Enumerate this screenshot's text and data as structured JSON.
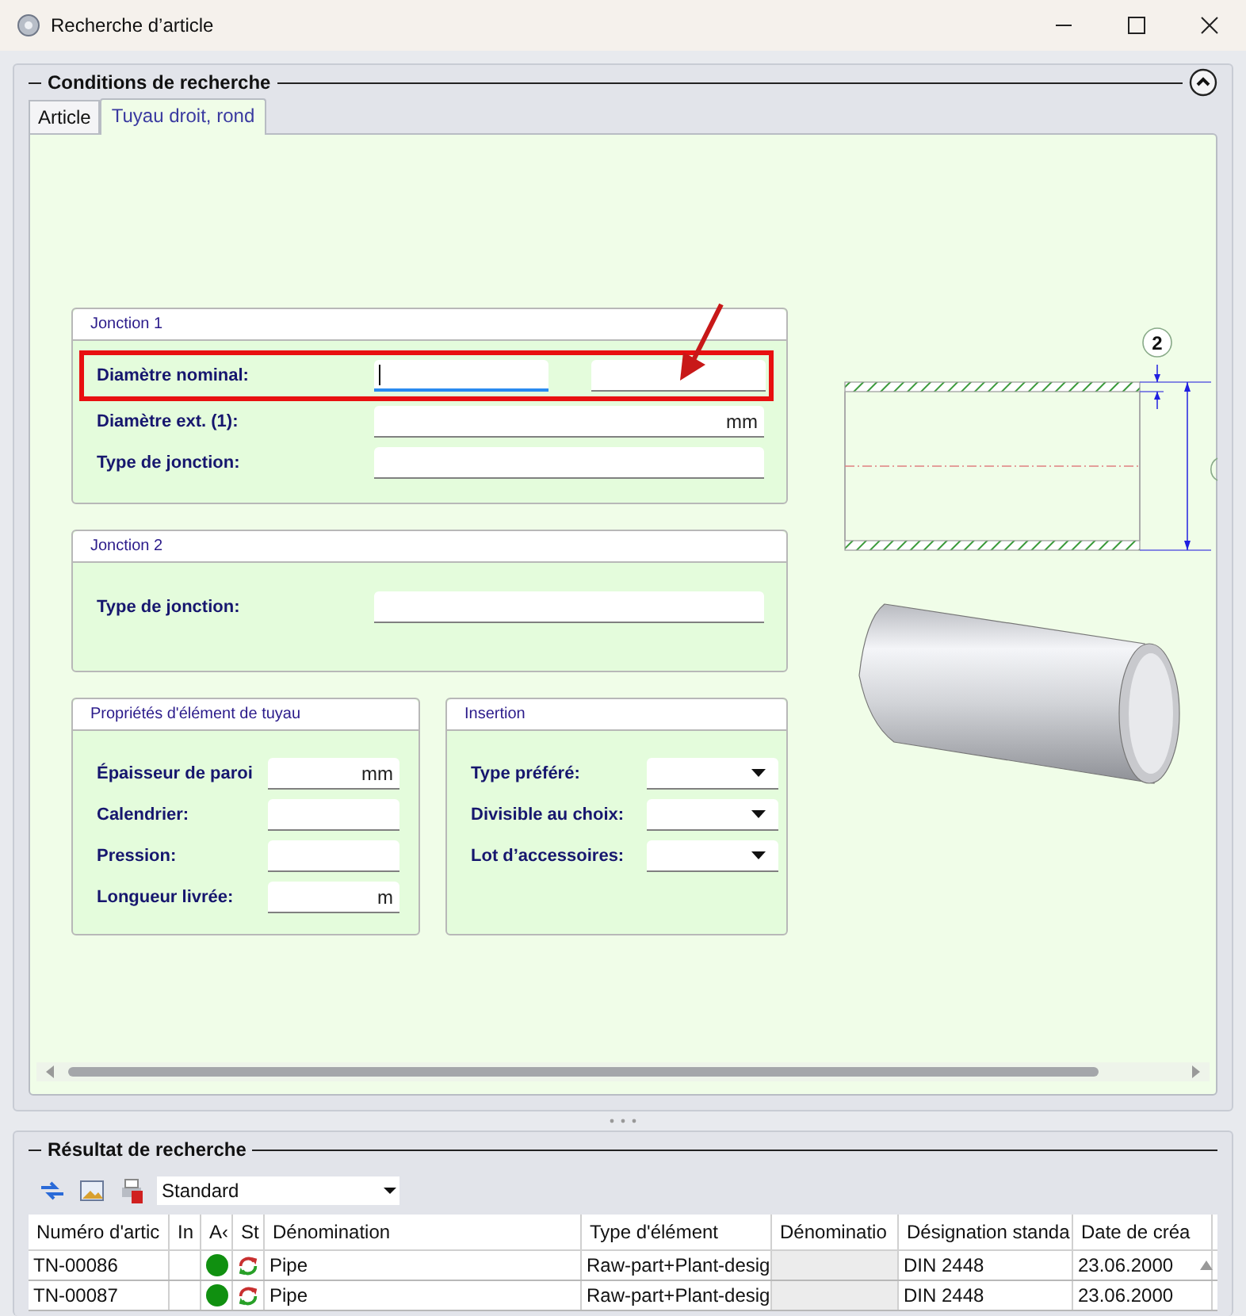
{
  "window": {
    "title": "Recherche d’article"
  },
  "conditions": {
    "title": "Conditions de recherche",
    "expanded": true,
    "tabs": [
      {
        "label": "Article",
        "selected": false
      },
      {
        "label": "Tuyau droit, rond",
        "selected": true
      }
    ],
    "groups": [
      {
        "title": "Jonction 1",
        "fields": [
          {
            "label": "Diamètre nominal:",
            "kind": "pair",
            "focused": true,
            "highlighted": true
          },
          {
            "label": "Diamètre ext. (1):",
            "kind": "text",
            "unit": "mm",
            "focused": false,
            "highlighted": false
          },
          {
            "label": "Type de jonction:",
            "kind": "text",
            "focused": false,
            "highlighted": false
          }
        ]
      },
      {
        "title": "Jonction 2",
        "fields": [
          {
            "label": "Type de jonction:",
            "kind": "text",
            "focused": false,
            "highlighted": false
          }
        ]
      }
    ],
    "small_groups": [
      {
        "title": "Propriétés d'élément de tuyau",
        "fields": [
          {
            "label": "Épaisseur de paroi",
            "kind": "text",
            "unit": "mm"
          },
          {
            "label": "Calendrier:",
            "kind": "text"
          },
          {
            "label": "Pression:",
            "kind": "text"
          },
          {
            "label": "Longueur livrée:",
            "kind": "text",
            "unit": "m"
          }
        ]
      },
      {
        "title": "Insertion",
        "fields": [
          {
            "label": "Type préféré:",
            "kind": "dropdown"
          },
          {
            "label": "Divisible au choix:",
            "kind": "dropdown"
          },
          {
            "label": "Lot d’accessoires:",
            "kind": "dropdown"
          }
        ]
      }
    ],
    "dimension_label": "2"
  },
  "results": {
    "title": "Résultat de recherche",
    "view": "Standard",
    "columns": [
      "Numéro d'artic",
      "In",
      "A‹",
      "St",
      "Dénomination",
      "Type d'élément",
      "Dénominatio",
      "Désignation standa",
      "Date de créa"
    ],
    "rows": [
      {
        "number": "TN-00086",
        "color": "#109010",
        "name": "Pipe",
        "type": "Raw-part+Plant-desig",
        "standard": "DIN 2448",
        "date": "23.06.2000"
      },
      {
        "number": "TN-00087",
        "color": "#109010",
        "name": "Pipe",
        "type": "Raw-part+Plant-desig",
        "standard": "DIN 2448",
        "date": "23.06.2000"
      }
    ]
  }
}
